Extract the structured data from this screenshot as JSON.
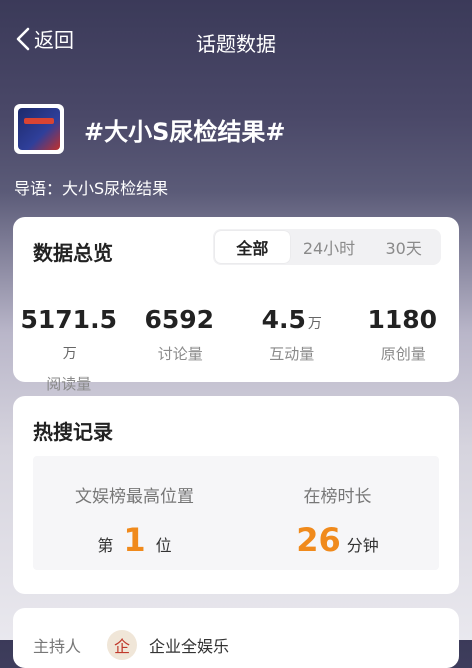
{
  "nav": {
    "back_label": "返回",
    "title": "话题数据"
  },
  "topic": {
    "name": "#大小S尿检结果#",
    "guide": "导语：大小S尿检结果"
  },
  "overview": {
    "title": "数据总览",
    "tabs": [
      {
        "label": "全部",
        "active": true
      },
      {
        "label": "24小时",
        "active": false
      },
      {
        "label": "30天",
        "active": false
      }
    ],
    "stats": [
      {
        "value": "5171.5",
        "unit": "万",
        "label": "阅读量"
      },
      {
        "value": "6592",
        "unit": "",
        "label": "讨论量"
      },
      {
        "value": "4.5",
        "unit": "万",
        "label": "互动量"
      },
      {
        "value": "1180",
        "unit": "",
        "label": "原创量"
      }
    ]
  },
  "hot": {
    "title": "热搜记录",
    "best_position": {
      "label": "文娱榜最高位置",
      "prefix": "第",
      "value": "1",
      "suffix": "位"
    },
    "duration": {
      "label": "在榜时长",
      "value": "26",
      "suffix": "分钟"
    }
  },
  "host": {
    "label": "主持人",
    "avatar_text": "企",
    "name": "企业全娱乐"
  },
  "colors": {
    "accent": "#f08a1c"
  }
}
